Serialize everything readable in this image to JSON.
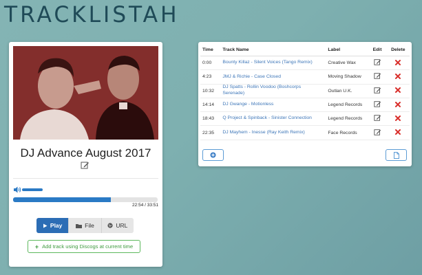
{
  "app": {
    "title": "TRACKLISTAH"
  },
  "player": {
    "mix_title": "DJ Advance August 2017",
    "volume_level": 0.8,
    "progress_fraction": 0.675,
    "time_readout": "22:54 / 33:51",
    "source_buttons": [
      {
        "label": "Play",
        "icon": "play-icon",
        "active": true
      },
      {
        "label": "File",
        "icon": "folder-icon",
        "active": false
      },
      {
        "label": "URL",
        "icon": "globe-icon",
        "active": false
      }
    ],
    "add_track_label": "Add track using Discogs at current time",
    "cover_color": "#7a2a28"
  },
  "tracklist": {
    "columns": [
      "Time",
      "Track Name",
      "Label",
      "Edit",
      "Delete"
    ],
    "rows": [
      {
        "time": "0:00",
        "track": "Bounty Killaz - Silent Voices (Tango Remix)",
        "label": "Creative Wax"
      },
      {
        "time": "4:23",
        "track": "JMJ & Richie - Case Closed",
        "label": "Moving Shadow"
      },
      {
        "time": "10:32",
        "track": "DJ Spatts - Rollin Voodoo (Boshcorps Serenade)",
        "label": "Outlan U.K."
      },
      {
        "time": "14:14",
        "track": "DJ Gwange - Motionless",
        "label": "Legend Records"
      },
      {
        "time": "18:43",
        "track": "Q Project & Spinback - Sinister Connection",
        "label": "Legend Records"
      },
      {
        "time": "22:35",
        "track": "DJ Mayhem - Inesse (Ray Keith Remix)",
        "label": "Face Records"
      }
    ]
  },
  "colors": {
    "accent": "#2c6db5",
    "link": "#3d76b8",
    "success": "#5cb85c",
    "danger": "#d9302c",
    "title": "#1f4a57"
  }
}
